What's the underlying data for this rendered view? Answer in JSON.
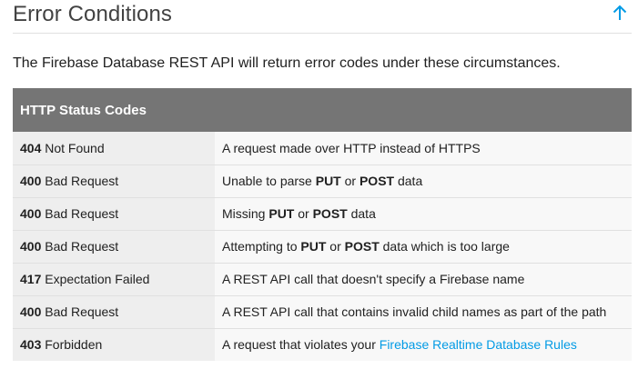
{
  "heading": {
    "title": "Error Conditions",
    "up_icon": "arrow-up-icon"
  },
  "intro": "The Firebase Database REST API will return error codes under these circumstances.",
  "table": {
    "header": "HTTP Status Codes",
    "rows": [
      {
        "code": "404",
        "status": "Not Found",
        "desc": [
          {
            "text": "A request made over HTTP instead of HTTPS"
          }
        ]
      },
      {
        "code": "400",
        "status": "Bad Request",
        "desc": [
          {
            "text": "Unable to parse "
          },
          {
            "text": "PUT",
            "bold": true
          },
          {
            "text": " or "
          },
          {
            "text": "POST",
            "bold": true
          },
          {
            "text": " data"
          }
        ]
      },
      {
        "code": "400",
        "status": "Bad Request",
        "desc": [
          {
            "text": "Missing "
          },
          {
            "text": "PUT",
            "bold": true
          },
          {
            "text": " or "
          },
          {
            "text": "POST",
            "bold": true
          },
          {
            "text": " data"
          }
        ]
      },
      {
        "code": "400",
        "status": "Bad Request",
        "desc": [
          {
            "text": "Attempting to "
          },
          {
            "text": "PUT",
            "bold": true
          },
          {
            "text": " or "
          },
          {
            "text": "POST",
            "bold": true
          },
          {
            "text": " data which is too large"
          }
        ]
      },
      {
        "code": "417",
        "status": "Expectation Failed",
        "desc": [
          {
            "text": "A REST API call that doesn't specify a Firebase name"
          }
        ]
      },
      {
        "code": "400",
        "status": "Bad Request",
        "desc": [
          {
            "text": "A REST API call that contains invalid child names as part of the path"
          }
        ]
      },
      {
        "code": "403",
        "status": "Forbidden",
        "desc": [
          {
            "text": "A request that violates your "
          },
          {
            "text": "Firebase Realtime Database Rules",
            "link": true
          }
        ]
      }
    ]
  },
  "colors": {
    "header_bg": "#757575",
    "code_cell_bg": "#eeeeee",
    "desc_cell_bg": "#f8f8f8",
    "link": "#039be5"
  }
}
